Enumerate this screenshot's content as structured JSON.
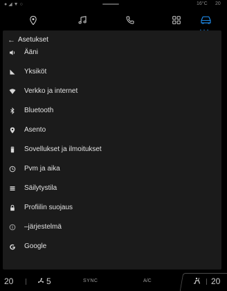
{
  "status_bar": {
    "temperature": "16°C",
    "time": "20"
  },
  "top_nav": {
    "items": [
      {
        "icon": "location-pin-icon"
      },
      {
        "icon": "music-note-icon"
      },
      {
        "icon": "phone-icon"
      },
      {
        "icon": "apps-grid-icon"
      },
      {
        "icon": "car-icon",
        "active": true
      }
    ],
    "active_indicator": "• • •",
    "accent_color": "#1e88e5"
  },
  "settings": {
    "back_icon": "back-arrow-icon",
    "title": "Asetukset",
    "items": [
      {
        "icon": "speaker-icon",
        "label": "Ääni"
      },
      {
        "icon": "ruler-icon",
        "label": "Yksiköt"
      },
      {
        "icon": "wifi-icon",
        "label": "Verkko ja internet"
      },
      {
        "icon": "bluetooth-icon",
        "label": "Bluetooth"
      },
      {
        "icon": "location-pin-icon",
        "label": "Asento"
      },
      {
        "icon": "apps-notifications-icon",
        "label": "Sovellukset ja ilmoitukset"
      },
      {
        "icon": "clock-icon",
        "label": "Pvm ja aika"
      },
      {
        "icon": "storage-icon",
        "label": "Säilytystila"
      },
      {
        "icon": "lock-icon",
        "label": "Profiilin suojaus"
      },
      {
        "icon": "info-icon",
        "label": "–järjestelmä"
      },
      {
        "icon": "google-icon",
        "label": "Google"
      }
    ]
  },
  "bottom_bar": {
    "temp_left": "20",
    "fan_level": "5",
    "sync_label": "SYNC",
    "ac_label": "A/C",
    "temp_right": "20"
  }
}
